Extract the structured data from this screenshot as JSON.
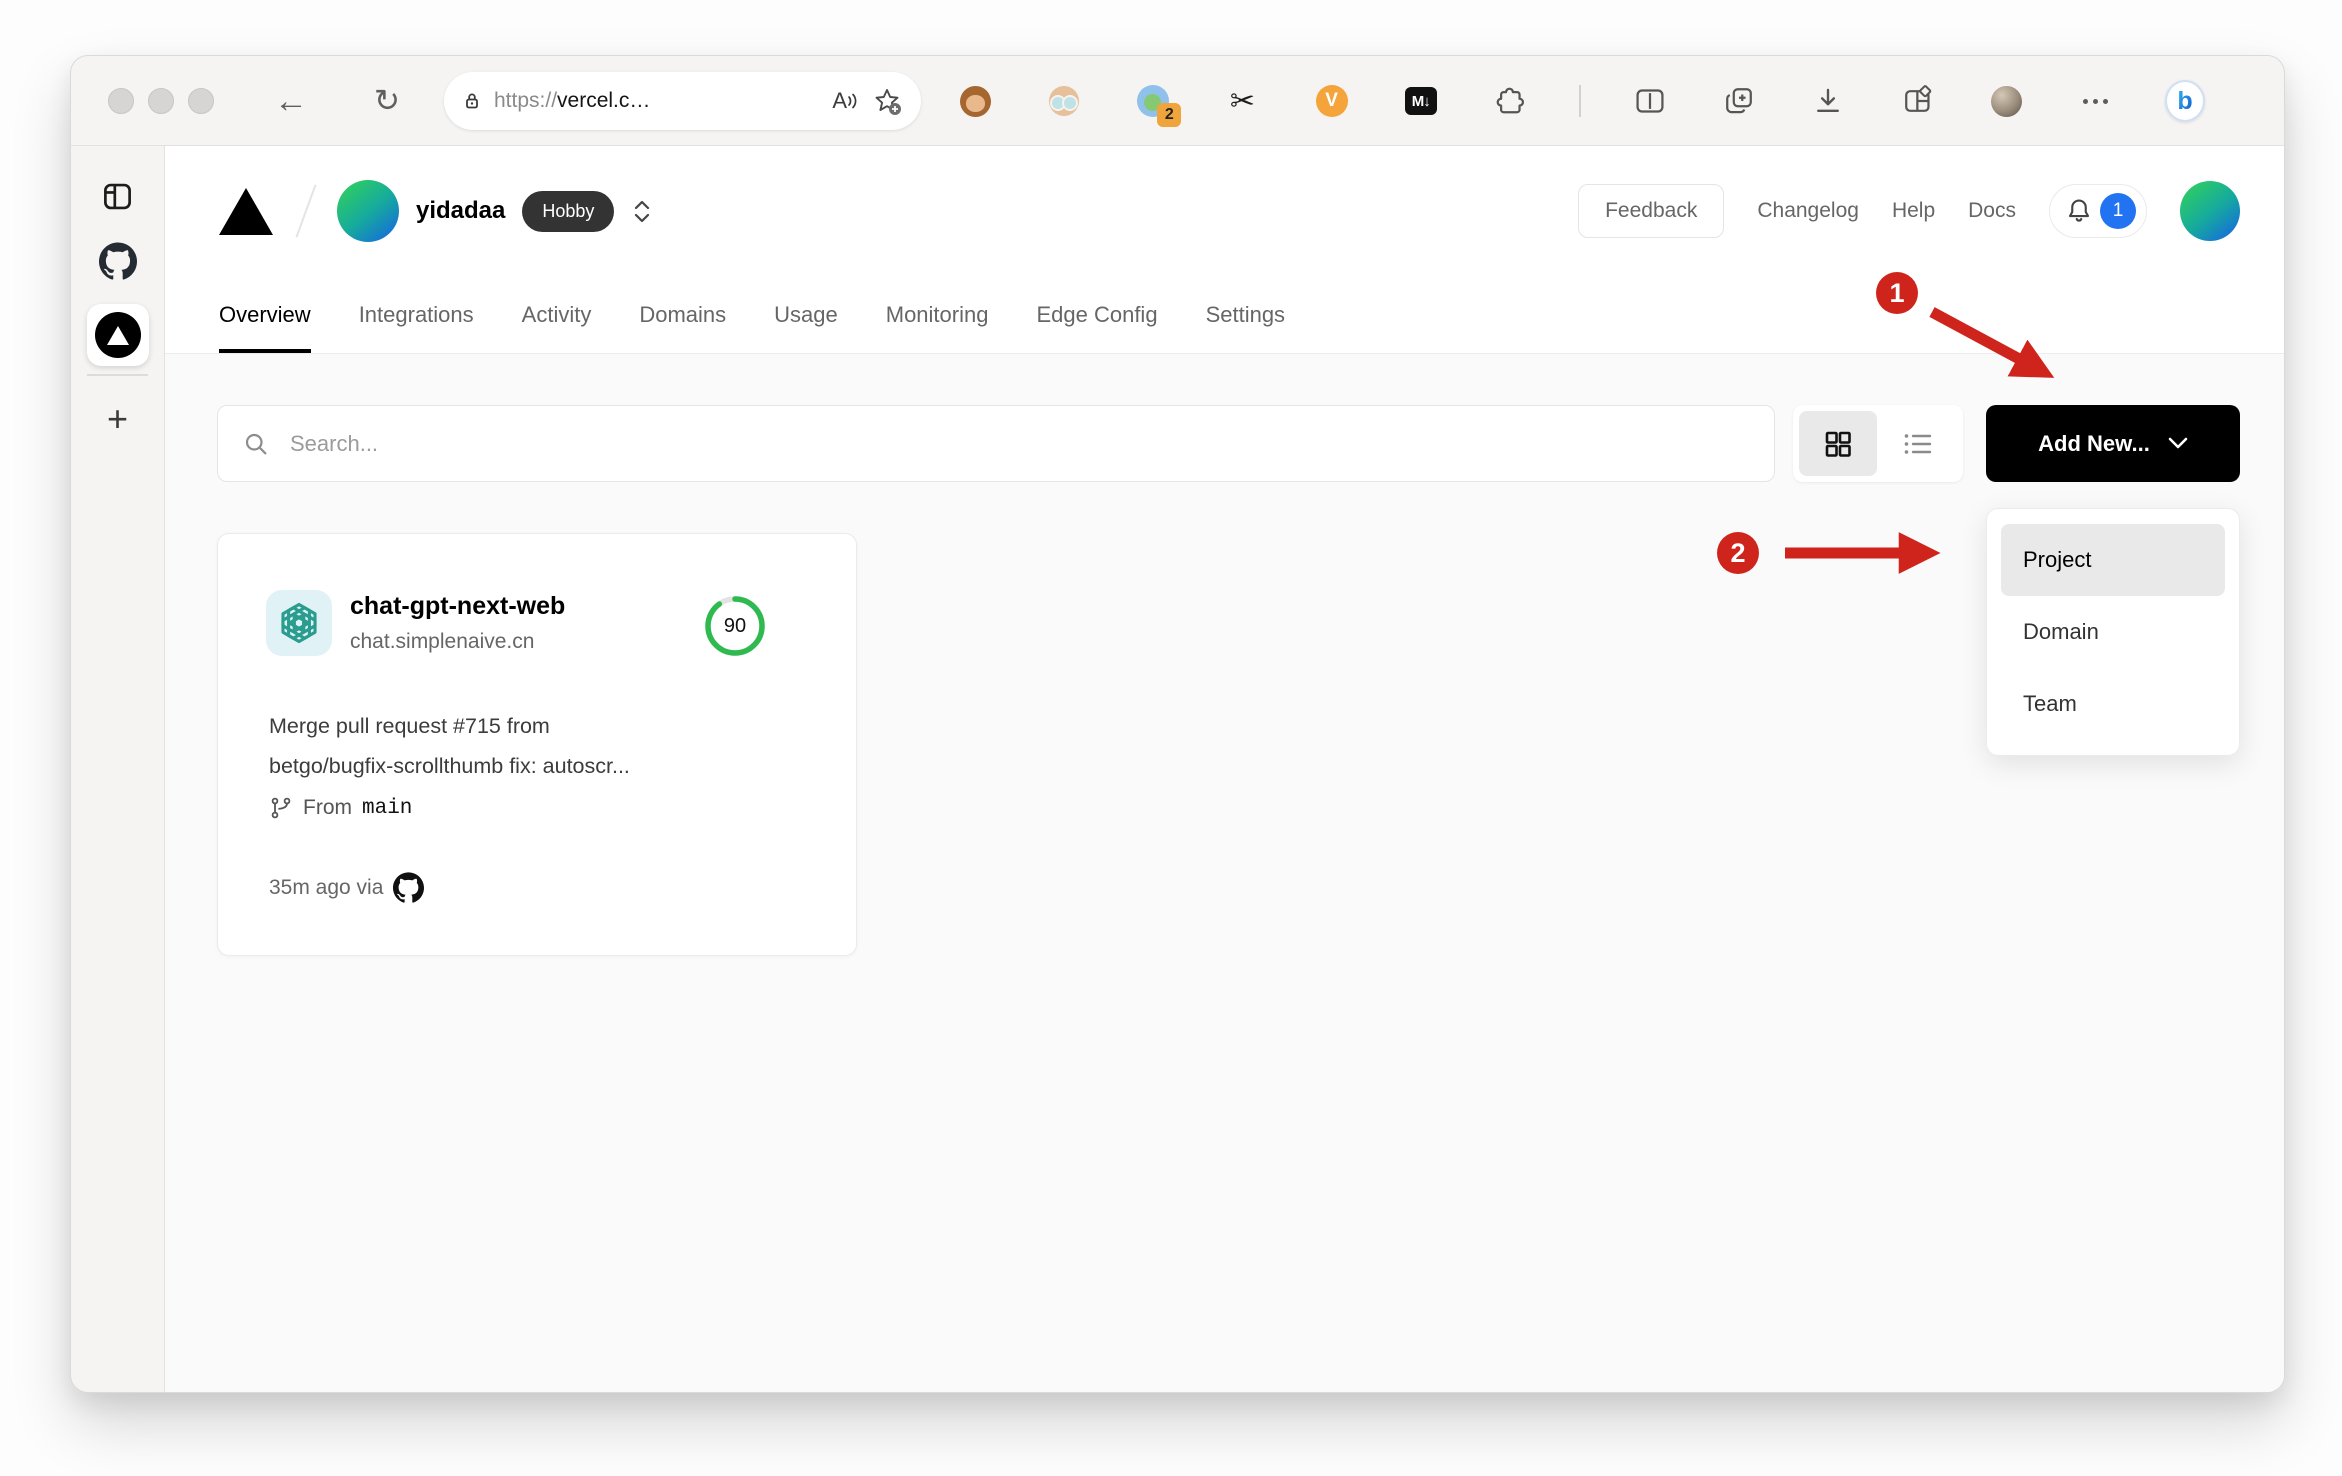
{
  "browser": {
    "url_scheme": "https://",
    "url_host": "vercel.c…",
    "extensions": {
      "badge_count": "2",
      "video_label": "V",
      "markdown_label": "M↓",
      "bing_label": "b"
    }
  },
  "vercel": {
    "header": {
      "team_name": "yidadaa",
      "plan_badge": "Hobby",
      "feedback": "Feedback",
      "changelog": "Changelog",
      "help": "Help",
      "docs": "Docs",
      "notification_count": "1"
    },
    "tabs": [
      {
        "label": "Overview",
        "active": true
      },
      {
        "label": "Integrations"
      },
      {
        "label": "Activity"
      },
      {
        "label": "Domains"
      },
      {
        "label": "Usage"
      },
      {
        "label": "Monitoring"
      },
      {
        "label": "Edge Config"
      },
      {
        "label": "Settings"
      }
    ],
    "controls": {
      "search_placeholder": "Search...",
      "add_new": "Add New...",
      "view_mode": "grid"
    },
    "dropdown": [
      {
        "label": "Project",
        "highlighted": true
      },
      {
        "label": "Domain"
      },
      {
        "label": "Team"
      }
    ],
    "project_card": {
      "name": "chat-gpt-next-web",
      "domain": "chat.simplenaive.cn",
      "score": "90",
      "commit_message_line1": "Merge pull request #715 from",
      "commit_message_line2": "betgo/bugfix-scrollthumb fix: autoscr...",
      "branch_prefix": "From",
      "branch": "main",
      "deployed_text": "35m ago via"
    }
  },
  "annotations": {
    "step1": "1",
    "step2": "2"
  },
  "colors": {
    "annotation_red": "#cf241b",
    "score_green": "#2fba50",
    "notification_blue": "#2173f2",
    "add_new_bg": "#000000",
    "content_bg": "#fafafa",
    "chrome_bg": "#f5f4f2",
    "openai_teal": "#2a9d8f"
  }
}
